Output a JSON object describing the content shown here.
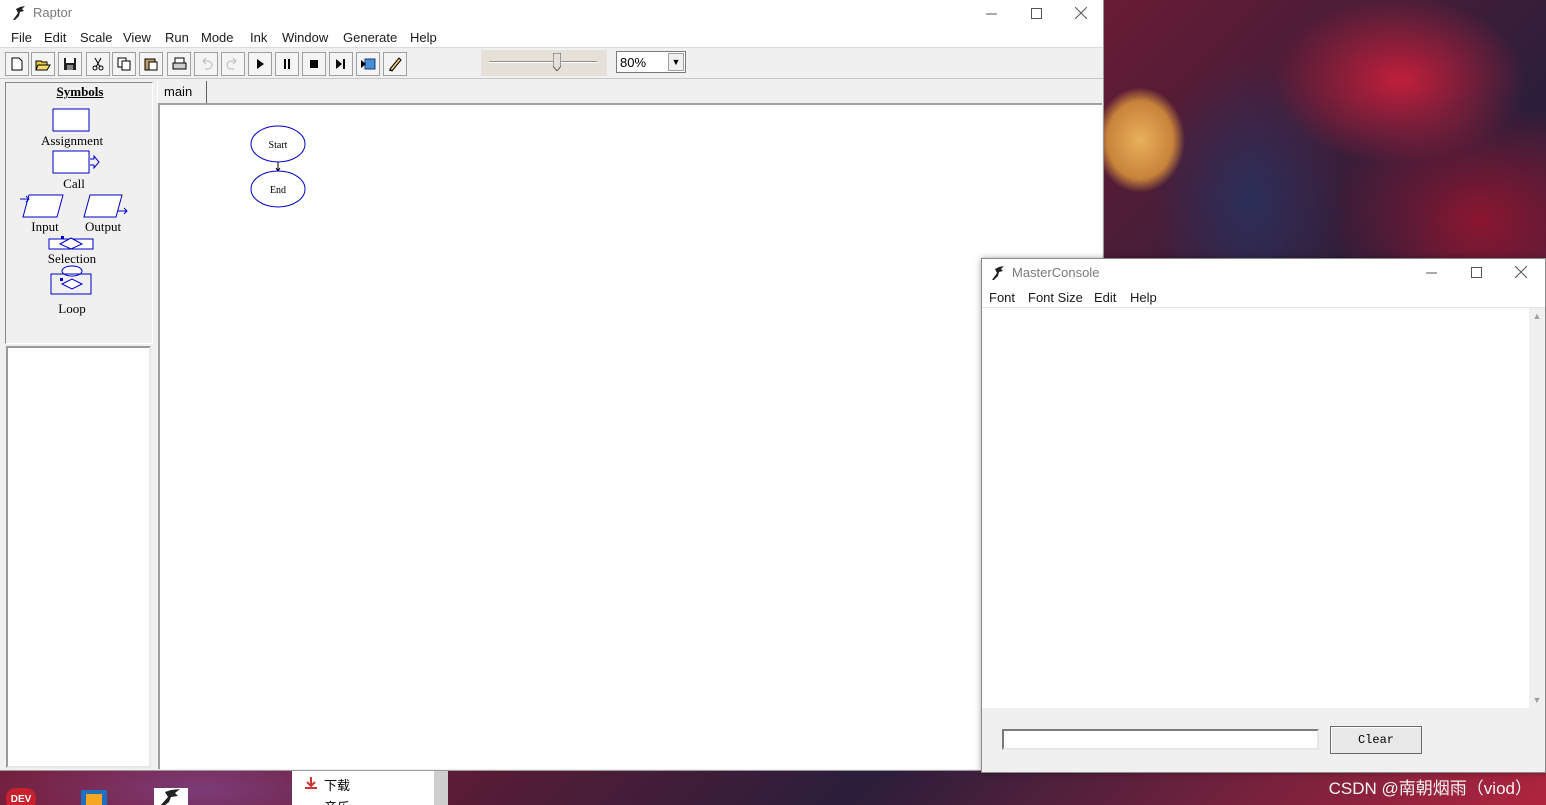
{
  "raptor": {
    "title": "Raptor",
    "menu": [
      "File",
      "Edit",
      "Scale",
      "View",
      "Run",
      "Mode",
      "Ink",
      "Window",
      "Generate",
      "Help"
    ],
    "toolbar": {
      "buttons": [
        "new-icon",
        "open-icon",
        "save-icon",
        "cut-icon",
        "copy-icon",
        "paste-icon",
        "print-icon",
        "undo-icon",
        "redo-icon",
        "play-icon",
        "pause-icon",
        "stop-icon",
        "step-icon",
        "test-server-icon",
        "pen-icon"
      ],
      "zoom": "80%"
    },
    "symbols": {
      "heading": "Symbols",
      "items": [
        "Assignment",
        "Call",
        "Input",
        "Output",
        "Selection",
        "Loop"
      ]
    },
    "tabs": [
      "main"
    ],
    "flowchart": {
      "start": "Start",
      "end": "End"
    },
    "colors": {
      "flowchart_stroke": "#0000c8"
    }
  },
  "console": {
    "title": "MasterConsole",
    "menu": [
      "Font",
      "Font Size",
      "Edit",
      "Help"
    ],
    "clear": "Clear",
    "input_value": ""
  },
  "desktop": {
    "explorer_items": [
      "下载",
      "音乐"
    ],
    "taskbar_labels": [
      "DEV"
    ],
    "watermark": "CSDN @南朝烟雨（viod）"
  }
}
